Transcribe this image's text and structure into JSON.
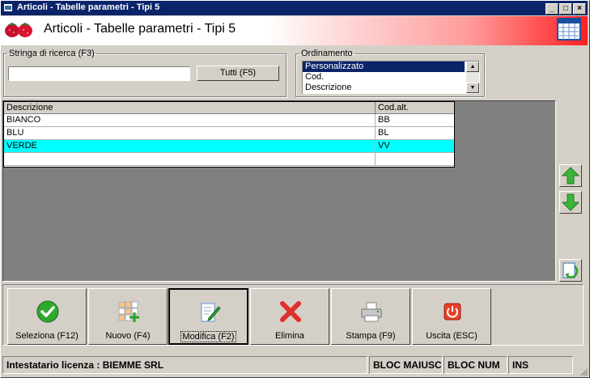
{
  "window": {
    "title": "Articoli - Tabelle parametri - Tipi 5",
    "controls": [
      "_",
      "□",
      "×"
    ]
  },
  "header": {
    "title": "Articoli - Tabelle parametri - Tipi 5"
  },
  "search": {
    "legend": "Stringa di ricerca (F3)",
    "value": "",
    "all_button": "Tutti (F5)"
  },
  "ordering": {
    "legend": "Ordinamento",
    "options": [
      "Personalizzato",
      "Cod.",
      "Descrizione"
    ],
    "selected": "Personalizzato"
  },
  "grid": {
    "columns": [
      "Descrizione",
      "Cod.alt."
    ],
    "rows": [
      {
        "descrizione": "BIANCO",
        "cod_alt": "BB"
      },
      {
        "descrizione": "BLU",
        "cod_alt": "BL"
      },
      {
        "descrizione": "VERDE",
        "cod_alt": "VV"
      },
      {
        "descrizione": "",
        "cod_alt": ""
      }
    ],
    "selected_row": 2
  },
  "toolbar": {
    "seleziona": "Seleziona (F12)",
    "nuovo": "Nuovo (F4)",
    "modifica": "Modifica (F2)",
    "elimina": "Elimina",
    "stampa": "Stampa (F9)",
    "uscita": "Uscita (ESC)"
  },
  "status": {
    "license": "Intestatario licenza : BIEMME SRL",
    "caps": "BLOC MAIUSC",
    "num": "BLOC NUM",
    "ins": "INS"
  },
  "colors": {
    "titlebar": "#0a246a",
    "selected_row": "#00ffff",
    "header_gradient_end": "#ff2020"
  }
}
